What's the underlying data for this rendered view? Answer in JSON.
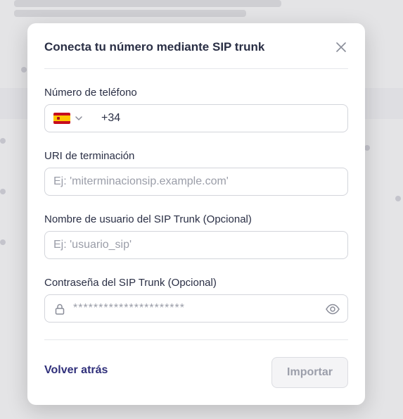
{
  "modal": {
    "title": "Conecta tu número mediante SIP trunk"
  },
  "phone": {
    "label": "Número de teléfono",
    "country_flag": "spain-flag",
    "dial_code": "+34"
  },
  "uri": {
    "label": "URI de terminación",
    "placeholder": "Ej: 'miterminacionsip.example.com'"
  },
  "username": {
    "label": "Nombre de usuario del SIP Trunk (Opcional)",
    "placeholder": "Ej: 'usuario_sip'"
  },
  "password": {
    "label": "Contraseña del SIP Trunk (Opcional)",
    "placeholder": "**********************"
  },
  "footer": {
    "back_label": "Volver atrás",
    "import_label": "Importar"
  },
  "colors": {
    "accent": "#2f2f7a",
    "text": "#2a2f45",
    "disabled_text": "#9b9eaa"
  }
}
